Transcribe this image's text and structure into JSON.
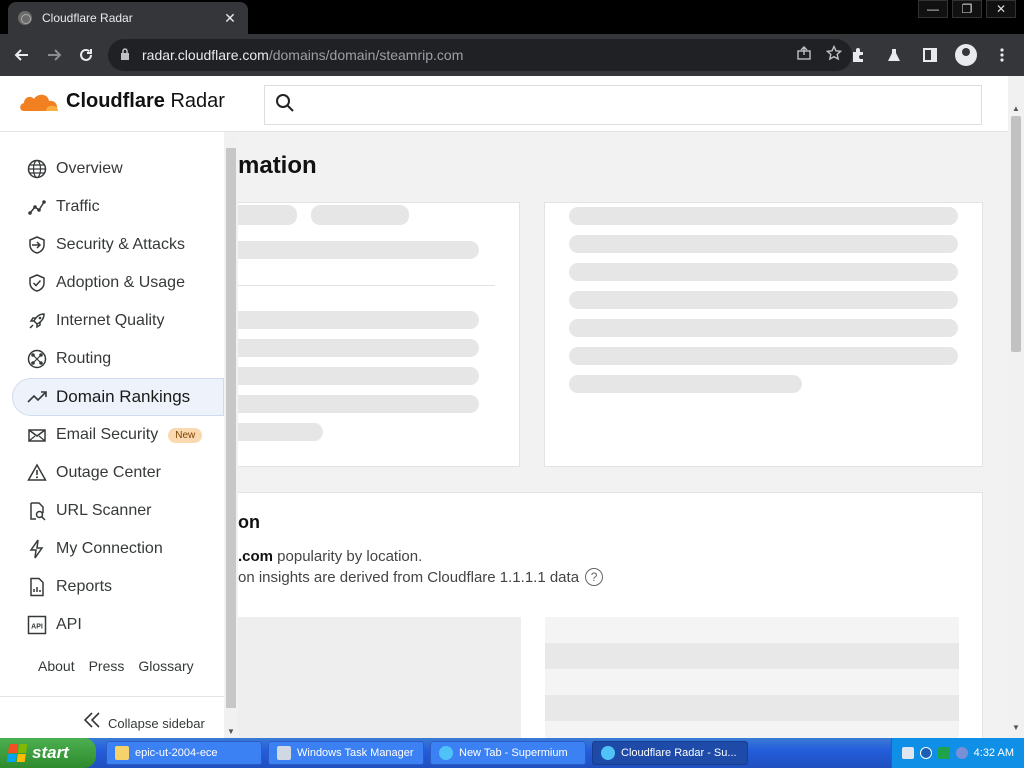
{
  "browser": {
    "tab_title": "Cloudflare Radar",
    "tab_close": "✕",
    "url_host": "radar.cloudflare.com",
    "url_path": "/domains/domain/steamrip.com",
    "window_controls": [
      "—",
      "❐",
      "✕"
    ]
  },
  "site": {
    "brand_bold": "Cloudflare",
    "brand_light": " Radar",
    "search_placeholder": ""
  },
  "sidebar": {
    "items": [
      {
        "label": "Overview",
        "icon": "globe-icon"
      },
      {
        "label": "Traffic",
        "icon": "traffic-line-icon"
      },
      {
        "label": "Security & Attacks",
        "icon": "shield-arrow-icon"
      },
      {
        "label": "Adoption & Usage",
        "icon": "shield-check-icon"
      },
      {
        "label": "Internet Quality",
        "icon": "rocket-icon"
      },
      {
        "label": "Routing",
        "icon": "routing-icon"
      },
      {
        "label": "Domain Rankings",
        "icon": "trending-icon",
        "active": true
      },
      {
        "label": "Email Security",
        "icon": "envelope-icon",
        "badge": "New"
      },
      {
        "label": "Outage Center",
        "icon": "warning-icon"
      },
      {
        "label": "URL Scanner",
        "icon": "url-scanner-icon"
      },
      {
        "label": "My Connection",
        "icon": "bolt-icon"
      },
      {
        "label": "Reports",
        "icon": "report-icon"
      },
      {
        "label": "API",
        "icon": "api-icon"
      }
    ],
    "links": [
      "About",
      "Press",
      "Glossary"
    ],
    "collapse_label": "Collapse sidebar"
  },
  "main": {
    "section_title": "mation",
    "geo_title": "on",
    "geo_domain_fragment": ".com",
    "geo_line1_rest": " popularity by location.",
    "geo_line2": "on insights are derived from Cloudflare 1.1.1.1 data",
    "help_glyph": "?"
  },
  "taskbar": {
    "start_label": "start",
    "tasks": [
      {
        "label": "epic-ut-2004-ece",
        "icon": "folder-icon"
      },
      {
        "label": "Windows Task Manager",
        "icon": "task-manager-icon"
      },
      {
        "label": "New Tab - Supermium",
        "icon": "browser-icon"
      },
      {
        "label": "Cloudflare Radar - Su...",
        "icon": "browser-icon",
        "active": true
      }
    ],
    "clock": "4:32 AM"
  },
  "colors": {
    "accent": "#f38020",
    "active_nav_bg": "#eef3fb",
    "badge_new_bg": "#fbd9b0"
  }
}
